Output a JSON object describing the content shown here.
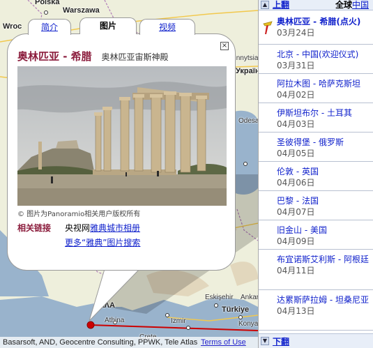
{
  "map": {
    "labels": [
      {
        "name": "poland",
        "text": "Polska"
      },
      {
        "name": "warsaw",
        "text": "Warszawa"
      },
      {
        "name": "wroclaw",
        "text": "Wroc"
      },
      {
        "name": "vinnytsia",
        "text": "Vinnytsia"
      },
      {
        "name": "ukraine",
        "text": "Україна"
      },
      {
        "name": "odessa",
        "text": "Odesa"
      },
      {
        "name": "eskisehir",
        "text": "Eskişehir"
      },
      {
        "name": "ankara",
        "text": "Ankara"
      },
      {
        "name": "turkey",
        "text": "Türkiye"
      },
      {
        "name": "konya",
        "text": "Konya"
      },
      {
        "name": "athens",
        "text": "Athina"
      },
      {
        "name": "greece",
        "text": "ΕΛΛΑ"
      },
      {
        "name": "izmir",
        "text": "Izmir"
      },
      {
        "name": "crete",
        "text": "Crete"
      }
    ],
    "attribution": "Basarsoft, AND, Geocentre Consulting, PPWK, Tele Atlas",
    "terms_label": "Terms of Use"
  },
  "infowindow": {
    "tabs": {
      "intro": "简介",
      "photos": "图片",
      "video": "视频"
    },
    "close_glyph": "×",
    "title_place": "奥林匹亚  - 希腊",
    "subtitle": "奥林匹亚宙斯神殿",
    "photo_caption": "© 图片为Panoramio相关用户版权所有",
    "related_label": "相关链接",
    "links": [
      {
        "prefix": "央视网",
        "link": "雅典城市相册"
      },
      {
        "prefix": "",
        "link": "更多“雅典”图片搜索"
      }
    ]
  },
  "sidebar": {
    "up_label": "上翻",
    "global_label": "全球",
    "china_label": "中国",
    "down_label": "下翻",
    "items": [
      {
        "city": "奥林匹亚  - 希腊(点火)",
        "date": "03月24日"
      },
      {
        "city": "北京  - 中国(欢迎仪式)",
        "date": "03月31日"
      },
      {
        "city": "阿拉木图  - 哈萨克斯坦",
        "date": "04月02日"
      },
      {
        "city": "伊斯坦布尔  - 土耳其",
        "date": "04月03日"
      },
      {
        "city": "圣彼得堡  - 俄罗斯",
        "date": "04月05日"
      },
      {
        "city": "伦敦  - 英国",
        "date": "04月06日"
      },
      {
        "city": "巴黎  - 法国",
        "date": "04月07日"
      },
      {
        "city": "旧金山  - 美国",
        "date": "04月09日"
      },
      {
        "city": "布宜诺斯艾利斯  - 阿根廷",
        "date": "04月11日"
      },
      {
        "city": "达累斯萨拉姆  - 坦桑尼亚",
        "date": "04月13日"
      }
    ]
  },
  "colors": {
    "title_accent": "#8b1c3c",
    "link": "#1122cc",
    "route": "#cc0000"
  }
}
